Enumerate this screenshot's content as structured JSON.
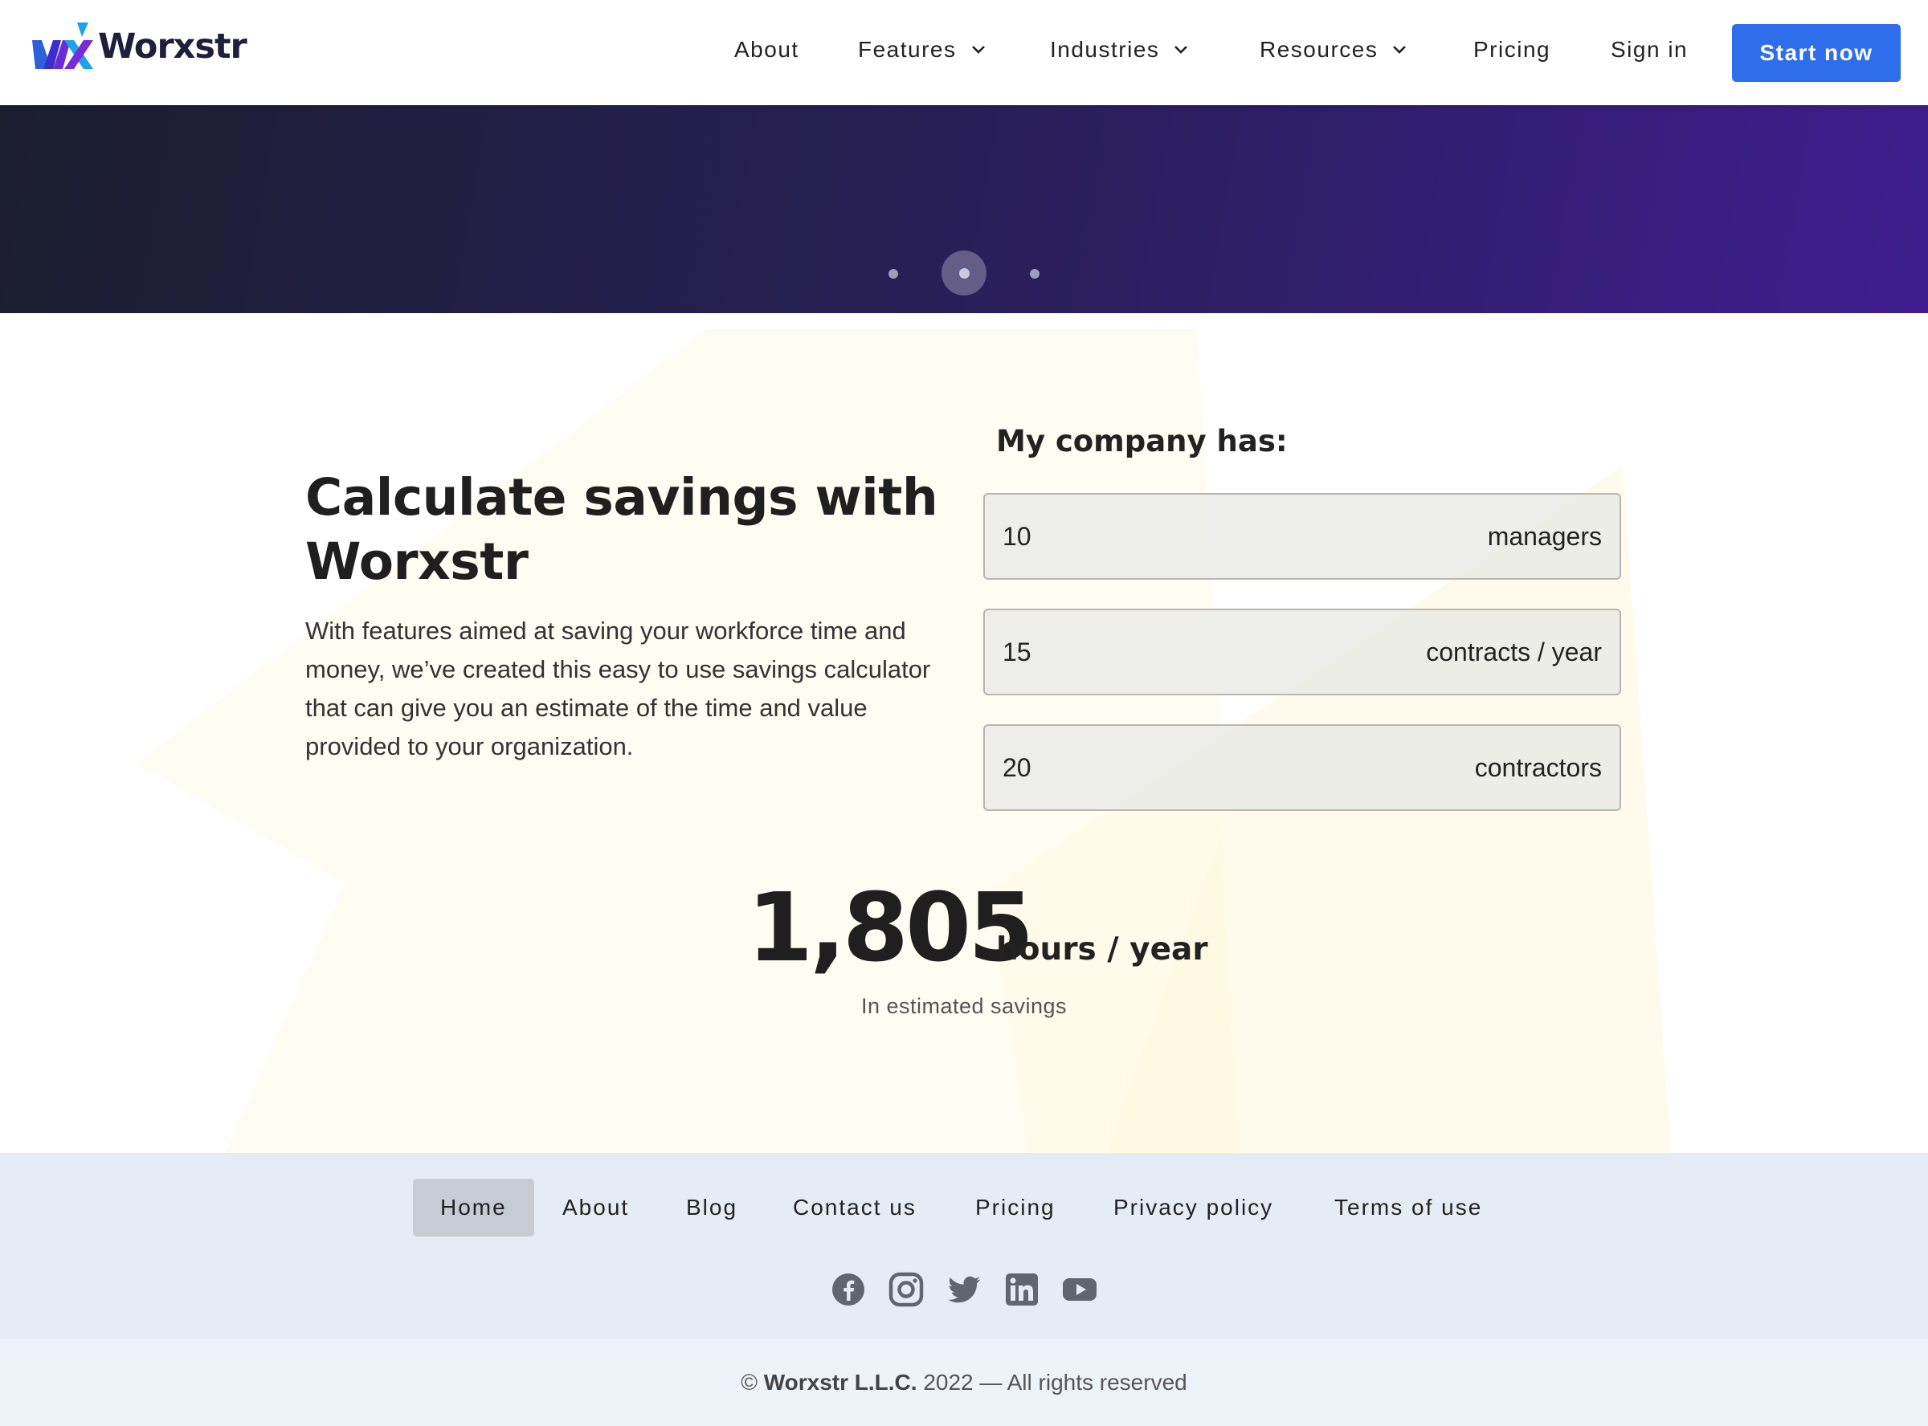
{
  "brand": {
    "name": "Worxstr"
  },
  "nav": {
    "about": "About",
    "features": "Features",
    "industries": "Industries",
    "resources": "Resources",
    "pricing": "Pricing",
    "sign_in": "Sign in",
    "start_now": "Start now"
  },
  "hero": {
    "carousel_dots": 3,
    "active_dot": 2
  },
  "calculator": {
    "title": "Calculate savings with Worxstr",
    "description": "With features aimed at saving your workforce time and money, we’ve created this easy to use savings calculator that can give you an estimate of the time and value provided to your organization.",
    "label": "My company has:",
    "fields": [
      {
        "value": "10",
        "unit": "managers"
      },
      {
        "value": "15",
        "unit": "contracts / year"
      },
      {
        "value": "20",
        "unit": "contractors"
      }
    ],
    "result": {
      "value": "1,805",
      "unit": "hours / year",
      "caption": "In estimated savings"
    }
  },
  "footer": {
    "links": [
      "Home",
      "About",
      "Blog",
      "Contact us",
      "Pricing",
      "Privacy policy",
      "Terms of use"
    ],
    "active_link": "Home",
    "social": [
      "facebook-icon",
      "instagram-icon",
      "twitter-icon",
      "linkedin-icon",
      "youtube-icon"
    ],
    "copyright_symbol": "©",
    "company": "Worxstr L.L.C.",
    "copyright_rest": "2022 — All rights reserved"
  },
  "colors": {
    "primary": "#2f6eea",
    "hero_start": "#1b1e2f",
    "hero_end": "#3e1e8f",
    "footer_bg": "#e6ecf5"
  }
}
